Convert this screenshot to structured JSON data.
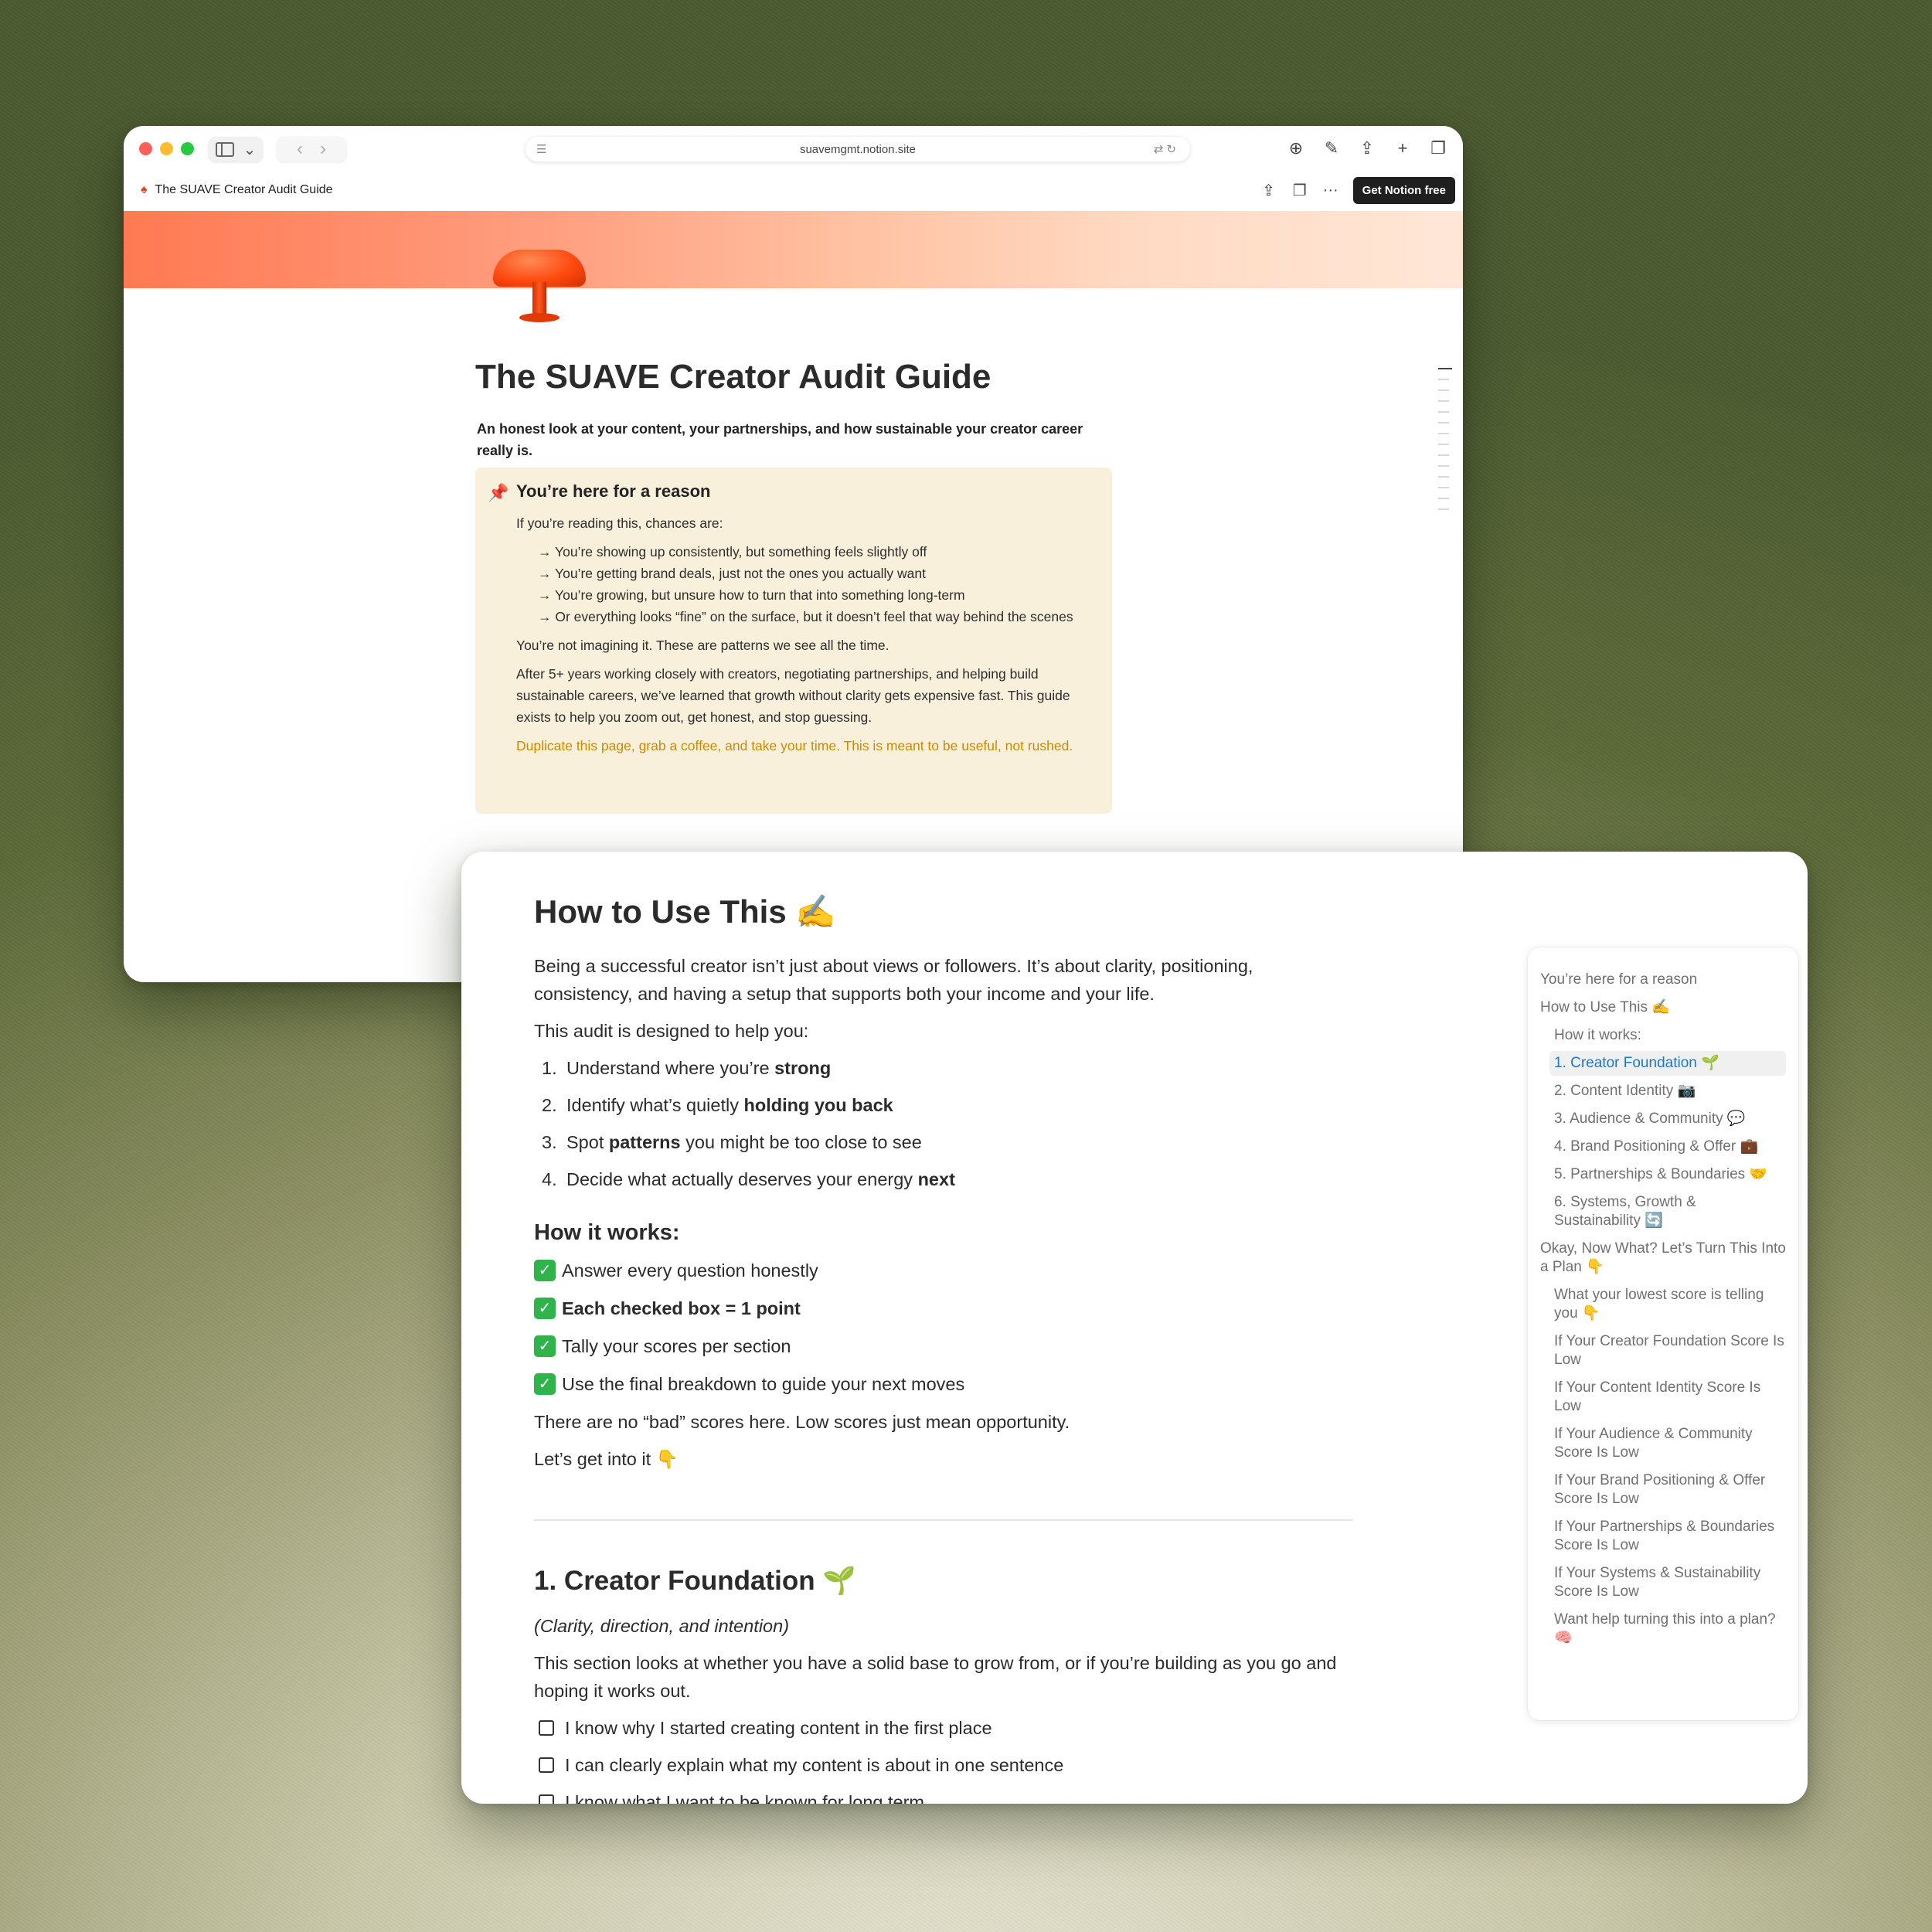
{
  "browser": {
    "url": "suavemgmt.notion.site",
    "back_glyph": "‹",
    "forward_glyph": "›",
    "chevron_glyph": "⌄"
  },
  "notion_bar": {
    "page_name": "The SUAVE Creator Audit Guide",
    "get_notion_label": "Get Notion free",
    "more_glyph": "···"
  },
  "page": {
    "title": "The SUAVE Creator Audit Guide",
    "subtitle": "An honest look at your content, your partnerships, and how sustainable your creator career really is.",
    "callout": {
      "icon": "📌",
      "title": "You’re here for a reason",
      "intro": "If you’re reading this, chances are:",
      "bullets": [
        "→ You’re showing up consistently, but something feels slightly off",
        "→ You’re getting brand deals, just not the ones you actually want",
        "→ You’re growing, but unsure how to turn that into something long-term",
        "→ Or everything looks “fine” on the surface, but it doesn’t feel that way behind the scenes"
      ],
      "para1": "You’re not imagining it. These are patterns we see all the time.",
      "para2": "After 5+ years working closely with creators, negotiating partnerships, and helping build sustainable careers, we’ve learned that growth without clarity gets expensive fast. This guide exists to help you zoom out, get honest, and stop guessing.",
      "highlight": "Duplicate this page, grab a coffee, and take your time. This is meant to be useful, not rushed."
    }
  },
  "how_to": {
    "title": "How to Use This ✍️",
    "intro": "Being a successful creator isn’t just about views or followers. It’s about clarity, positioning, consistency, and having a setup that supports both your income and your life.",
    "lead": "This audit is designed to help you:",
    "steps": [
      {
        "num": "1.",
        "text": "Understand where you’re ",
        "bold": "strong",
        "after": ""
      },
      {
        "num": "2.",
        "text": "Identify what’s quietly ",
        "bold": "holding you back",
        "after": ""
      },
      {
        "num": "3.",
        "text": "Spot ",
        "bold": "patterns",
        "after": " you might be too close to see"
      },
      {
        "num": "4.",
        "text": "Decide what actually deserves your energy ",
        "bold": "next",
        "after": ""
      }
    ],
    "works_title": "How it works:",
    "checks": [
      "Answer every question honestly",
      "Each checked box = 1 point",
      "Tally your scores per section",
      "Use the final breakdown to guide your next moves"
    ],
    "check_glyph": "✓",
    "note": "There are no “bad” scores here. Low scores just mean opportunity.",
    "lets_go": "Let’s get into it 👇"
  },
  "section1": {
    "title": "1. Creator Foundation 🌱",
    "tagline": "(Clarity, direction, and intention)",
    "intro": "This section looks at whether you have a solid base to grow from, or if you’re building as you go and hoping it works out.",
    "todos": [
      "I know why I started creating content in the first place",
      "I can clearly explain what my content is about in one sentence",
      "I know what I want to be known for long term"
    ]
  },
  "toc": [
    {
      "label": "You’re here for a reason",
      "level": 1
    },
    {
      "label": "How to Use This ✍️",
      "level": 1
    },
    {
      "label": "How it works:",
      "level": 2
    },
    {
      "label": "1. Creator Foundation 🌱",
      "level": 2,
      "active": true
    },
    {
      "label": "2. Content Identity 📷",
      "level": 2
    },
    {
      "label": "3. Audience & Community 💬",
      "level": 2
    },
    {
      "label": "4. Brand Positioning & Offer 💼",
      "level": 2
    },
    {
      "label": "5. Partnerships & Boundaries 🤝",
      "level": 2
    },
    {
      "label": "6. Systems, Growth & Sustainability 🔄",
      "level": 2
    },
    {
      "label": "Okay, Now What? Let’s Turn This Into a Plan 👇",
      "level": 1
    },
    {
      "label": "What your lowest score is telling you 👇",
      "level": 2
    },
    {
      "label": "If Your Creator Foundation Score Is Low",
      "level": 2
    },
    {
      "label": "If Your Content Identity Score Is Low",
      "level": 2
    },
    {
      "label": "If Your Audience & Community Score Is Low",
      "level": 2
    },
    {
      "label": "If Your Brand Positioning & Offer Score Is Low",
      "level": 2
    },
    {
      "label": "If Your Partnerships & Boundaries Score Is Low",
      "level": 2
    },
    {
      "label": "If Your Systems & Sustainability Score Is Low",
      "level": 2
    },
    {
      "label": "Want help turning this into a plan? 🧠",
      "level": 2
    }
  ],
  "colors": {
    "callout_bg": "#f9f0dc",
    "highlight_text": "#cc8a00",
    "toc_active": "#1a78c9",
    "check_green": "#2fb34a"
  }
}
